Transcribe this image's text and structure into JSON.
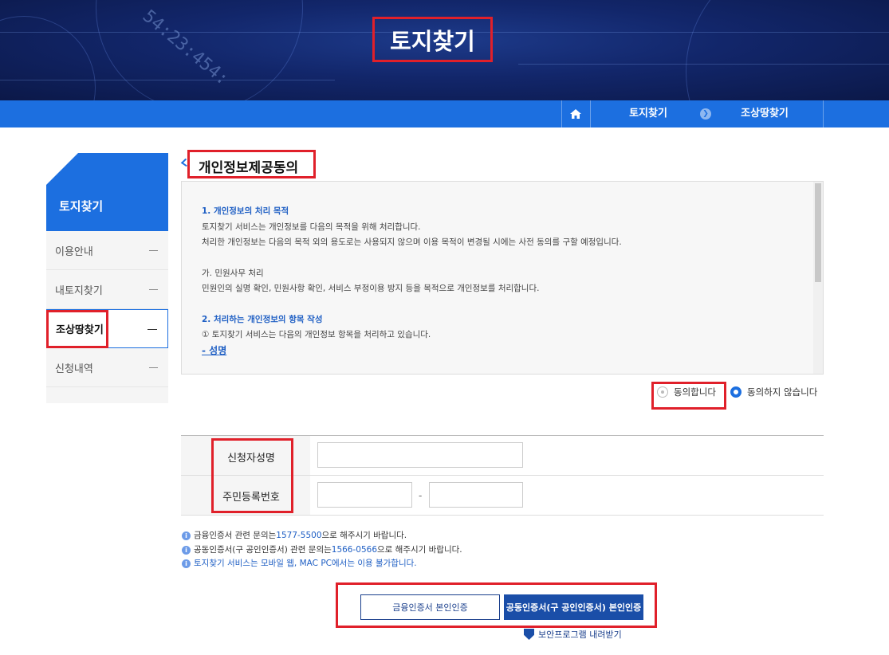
{
  "header": {
    "title": "토지찾기",
    "background_digits": "54:23:454:"
  },
  "breadcrumb": {
    "home_icon": "home-icon",
    "level1": "토지찾기",
    "level2": "조상땅찾기"
  },
  "sidebar": {
    "title": "토지찾기",
    "items": [
      {
        "label": "이용안내",
        "active": false
      },
      {
        "label": "내토지찾기",
        "active": false
      },
      {
        "label": "조상땅찾기",
        "active": true
      },
      {
        "label": "신청내역",
        "active": false
      }
    ]
  },
  "consent": {
    "title": "개인정보제공동의",
    "terms": {
      "sec1_title": "1. 개인정보의 처리 목적",
      "sec1_line1": "토지찾기 서비스는 개인정보를 다음의 목적을 위해 처리합니다.",
      "sec1_line2": "처리한 개인정보는 다음의 목적 외의 용도로는 사용되지 않으며 이용 목적이 변경될 시에는 사전 동의를 구할 예정입니다.",
      "sub_title": "가. 민원사무 처리",
      "sub_line": "민원인의 실명 확인, 민원사항 확인, 서비스 부정이용 방지 등을 목적으로 개인정보를 처리합니다.",
      "sec2_title": "2. 처리하는 개인정보의 항목 작성",
      "sec2_line": "① 토지찾기 서비스는 다음의 개인정보 항목을 처리하고 있습니다.",
      "sec2_link": "- 성명"
    },
    "agree_label": "동의합니다",
    "disagree_label": "동의하지 않습니다",
    "selected": "disagree"
  },
  "form": {
    "name_label": "신청자성명",
    "name_value": "",
    "rrn_label": "주민등록번호",
    "rrn_front": "",
    "rrn_back": "",
    "rrn_separator": "-"
  },
  "notes": [
    {
      "prefix": "금융인증서 관련 문의는 ",
      "phone": "1577-5500",
      "suffix": " 으로 해주시기 바랍니다."
    },
    {
      "prefix": "공동인증서(구 공인인증서) 관련 문의는 ",
      "phone": "1566-0566",
      "suffix": " 으로 해주시기 바랍니다."
    },
    {
      "text": "토지찾기 서비스는 모바일 웹, MAC PC에서는 이용 불가합니다."
    }
  ],
  "buttons": {
    "financial_cert": "금융인증서 본인인증",
    "joint_cert": "공동인증서(구 공인인증서) 본인인증",
    "download": "보안프로그램 내려받기"
  },
  "colors": {
    "primary": "#1c6fe0",
    "highlight": "#e0202a",
    "dark_button": "#1a4ea8"
  }
}
